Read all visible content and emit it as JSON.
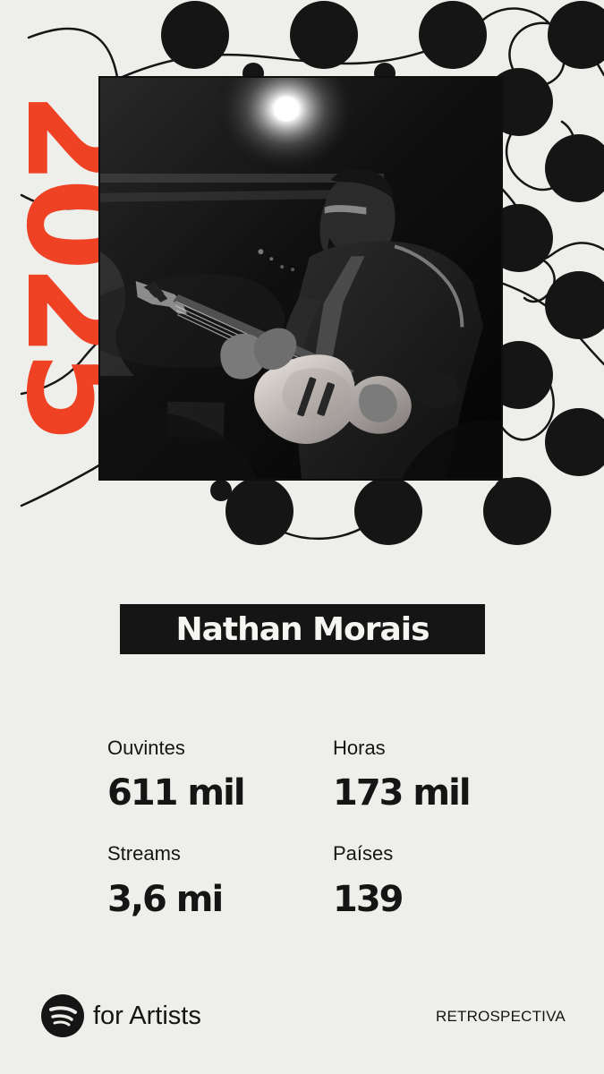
{
  "year": "2025",
  "artist": {
    "name": "Nathan Morais"
  },
  "stats": [
    {
      "label": "Ouvintes",
      "value": "611 mil"
    },
    {
      "label": "Horas",
      "value": "173 mil"
    },
    {
      "label": "Streams",
      "value": "3,6 mi"
    },
    {
      "label": "Países",
      "value": "139"
    }
  ],
  "footer": {
    "logo_icon": "spotify-icon",
    "logo_text": "for Artists",
    "tag": "RETROSPECTIVA"
  },
  "colors": {
    "background": "#eeeeeb",
    "accent": "#ef4124",
    "dark": "#151515",
    "text_on_dark": "#f5f5f2"
  }
}
